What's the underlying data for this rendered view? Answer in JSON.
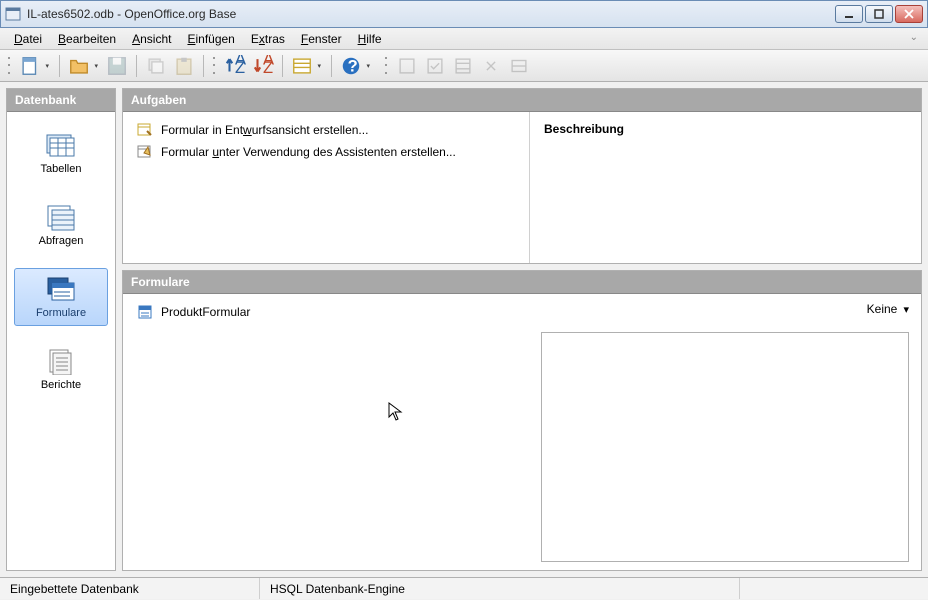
{
  "window": {
    "title": "IL-ates6502.odb - OpenOffice.org Base"
  },
  "menu": {
    "items": [
      "Datei",
      "Bearbeiten",
      "Ansicht",
      "Einfügen",
      "Extras",
      "Fenster",
      "Hilfe"
    ]
  },
  "sidebar": {
    "header": "Datenbank",
    "items": [
      {
        "label": "Tabellen"
      },
      {
        "label": "Abfragen"
      },
      {
        "label": "Formulare"
      },
      {
        "label": "Berichte"
      }
    ]
  },
  "tasks": {
    "header": "Aufgaben",
    "items": [
      {
        "pre": "Formular in Ent",
        "u": "w",
        "post": "urfsansicht erstellen..."
      },
      {
        "pre": "Formular ",
        "u": "u",
        "post": "nter Verwendung des Assistenten erstellen..."
      }
    ],
    "description_title": "Beschreibung"
  },
  "forms": {
    "header": "Formulare",
    "items": [
      {
        "label": "ProduktFormular"
      }
    ],
    "view_dropdown": "Keine"
  },
  "status": {
    "left": "Eingebettete Datenbank",
    "mid": "HSQL Datenbank-Engine"
  }
}
